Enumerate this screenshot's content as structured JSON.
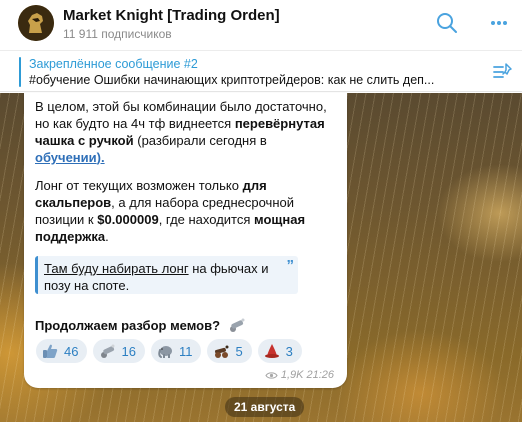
{
  "header": {
    "title": "Market Knight [Trading Orden]",
    "subscribers": "11 911 подписчиков",
    "icons": [
      "knight-avatar",
      "search-icon",
      "more-icon"
    ]
  },
  "pinned": {
    "title": "Закреплённое сообщение #2",
    "text": "#обучение  Ошибки начинающих криптотрейдеров: как не слить деп...",
    "icon": "pinned-list-icon",
    "accent": "#2e9bd6"
  },
  "message": {
    "p1_a": "В целом, этой бы комбинации было достаточно, но как будто на 4ч тф виднеется ",
    "p1_bold": "перевёрнутая чашка с ручкой",
    "p1_b": " (разбирали сегодня в ",
    "p1_link": "обучении",
    "p1_end": ").",
    "p2_a": "Лонг от текущих возможен только ",
    "p2_bold1": "для скальперов",
    "p2_b": ", а для набора среднесрочной позиции к ",
    "p2_bold2": "$0.000009",
    "p2_c": ", где находится ",
    "p2_bold3": "мощная поддержка",
    "p2_end": ".",
    "quote_link": "Там буду набирать лонг",
    "quote_rest": " на фьючах и позу на споте.",
    "quote_mark": "”",
    "p3": "Продолжаем разбор мемов?",
    "views": "1,9K",
    "time": "21:26"
  },
  "reactions": [
    {
      "emoji": "thumbs-up-icon",
      "count": "46"
    },
    {
      "emoji": "cannon-icon",
      "count": "16"
    },
    {
      "emoji": "elephant-icon",
      "count": "11"
    },
    {
      "emoji": "cannon-cart-icon",
      "count": "5"
    },
    {
      "emoji": "red-hat-icon",
      "count": "3"
    }
  ],
  "date_separator": "21 августа",
  "colors": {
    "link": "#2e6fb8",
    "reaction_text": "#2c7fc2",
    "reaction_bg": "#e8eef4",
    "quote_border": "#3e8fd0"
  }
}
